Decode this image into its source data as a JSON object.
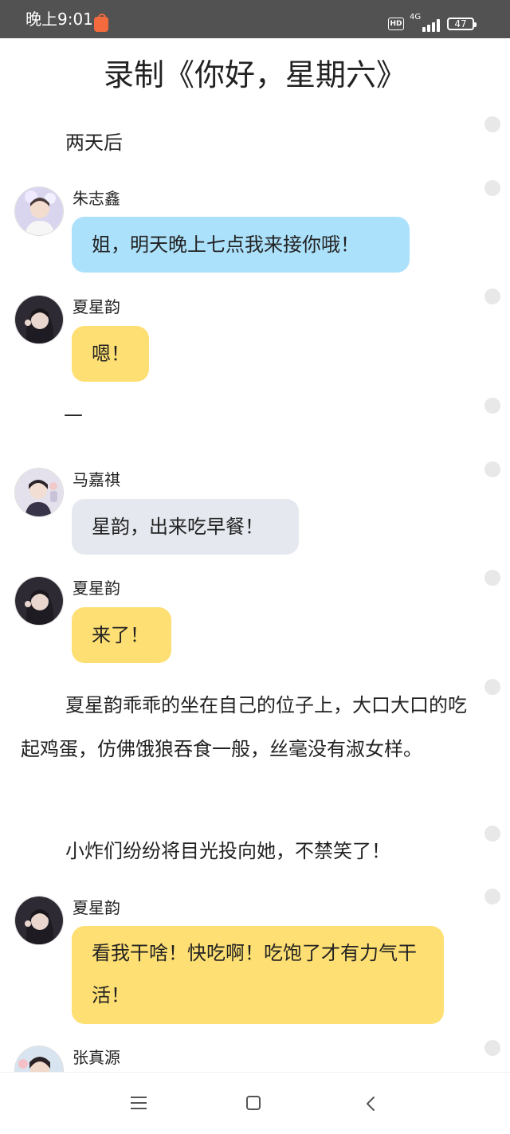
{
  "status_bar": {
    "time": "晚上9:01",
    "hd": "HD",
    "network": "4G",
    "battery": "47"
  },
  "title": "录制《你好，星期六》",
  "blocks": {
    "p1": "两天后",
    "c1": {
      "speaker": "朱志鑫",
      "text": "姐，明天晚上七点我来接你哦！"
    },
    "c2": {
      "speaker": "夏星韵",
      "text": "嗯！"
    },
    "divider": "—",
    "c3": {
      "speaker": "马嘉祺",
      "text": "星韵，出来吃早餐！"
    },
    "c4": {
      "speaker": "夏星韵",
      "text": "来了！"
    },
    "p2": "夏星韵乖乖的坐在自己的位子上，大口大口的吃起鸡蛋，仿佛饿狼吞食一般，丝毫没有淑女样。",
    "p3": "小炸们纷纷将目光投向她，不禁笑了！",
    "c5": {
      "speaker": "夏星韵",
      "text": "看我干啥！快吃啊！吃饱了才有力气干活！"
    },
    "c6": {
      "speaker": "张真源"
    }
  },
  "colors": {
    "bubble_blue": "#ace1fb",
    "bubble_yellow": "#fedf73",
    "bubble_gray": "#e5e9ef",
    "status_bar": "#525252"
  },
  "nav_icons": [
    "menu-icon",
    "home-icon",
    "back-icon"
  ]
}
